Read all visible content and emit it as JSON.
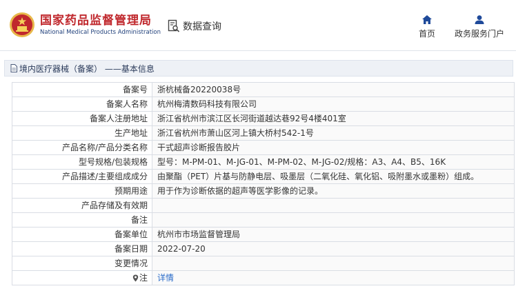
{
  "header": {
    "brand_cn": "国家药品监督管理局",
    "brand_en": "National Medical Products Administration",
    "query_label": "数据查询",
    "nav": {
      "home": "首页",
      "portal": "政务服务门户"
    }
  },
  "breadcrumb": "境内医疗器械（备案） ——基本信息",
  "rows": [
    {
      "label": "备案号",
      "value": "浙杭械备20220038号"
    },
    {
      "label": "备案人名称",
      "value": "杭州梅清数码科技有限公司"
    },
    {
      "label": "备案人注册地址",
      "value": "浙江省杭州市滨江区长河街道越达巷92号4楼401室"
    },
    {
      "label": "生产地址",
      "value": "浙江省杭州市萧山区河上镇大桥村542-1号"
    },
    {
      "label": "产品名称/产品分类名称",
      "value": "干式超声诊断报告胶片"
    },
    {
      "label": "型号规格/包装规格",
      "value": "型号：M-PM-01、M-JG-01、M-PM-02、M-JG-02/规格：A3、A4、B5、16K"
    },
    {
      "label": "产品描述/主要组成成分",
      "value": "由聚酯（PET）片基与防静电层、吸墨层（二氧化硅、氧化铝、吸附墨水或墨粉）组成。"
    },
    {
      "label": "预期用途",
      "value": "用于作为诊断依据的超声等医学影像的记录。"
    },
    {
      "label": "产品存储及有效期",
      "value": ""
    },
    {
      "label": "备注",
      "value": ""
    },
    {
      "label": "备案单位",
      "value": "杭州市市场监督管理局"
    },
    {
      "label": "备案日期",
      "value": "2022-07-20"
    },
    {
      "label": "变更情况",
      "value": ""
    }
  ],
  "note_row": {
    "label": "注",
    "value": "详情"
  },
  "colors": {
    "brand_red": "#c0282d",
    "brand_blue": "#1f3f7a",
    "link": "#2b6cc9"
  }
}
